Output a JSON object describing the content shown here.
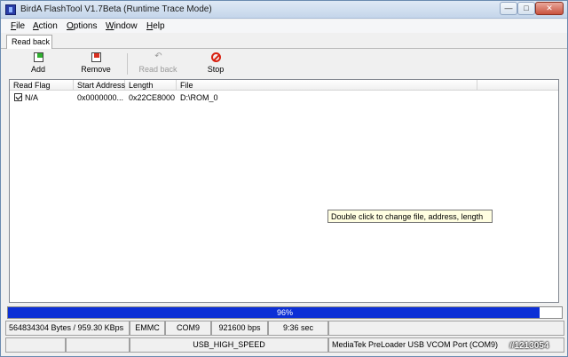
{
  "window": {
    "title": "BirdA FlashTool V1.7Beta (Runtime Trace Mode)"
  },
  "menu": [
    {
      "key": "F",
      "rest": "ile"
    },
    {
      "key": "A",
      "rest": "ction"
    },
    {
      "key": "O",
      "rest": "ptions"
    },
    {
      "key": "W",
      "rest": "indow"
    },
    {
      "key": "H",
      "rest": "elp"
    }
  ],
  "tabs": [
    {
      "label": "Read back"
    }
  ],
  "toolbar": {
    "add": "Add",
    "remove": "Remove",
    "read_back": "Read back",
    "stop": "Stop"
  },
  "list": {
    "columns": [
      "Read Flag",
      "Start Address",
      "Length",
      "File"
    ],
    "rows": [
      {
        "checked": true,
        "flag": "N/A",
        "start": "0x0000000...",
        "length": "0x22CE8000",
        "file": "D:\\ROM_0"
      }
    ]
  },
  "tooltip": "Double click to change file, address, length",
  "progress": {
    "percent": 96,
    "label": "96%"
  },
  "status": {
    "bytes": "564834304 Bytes / 959.30 KBps",
    "storage": "EMMC",
    "port": "COM9",
    "baud": "921600 bps",
    "time": "9:36 sec",
    "usb_speed": "USB_HIGH_SPEED",
    "device": "MediaTek PreLoader USB VCOM Port (COM9)"
  },
  "watermark": "#1213054",
  "colors": {
    "progress": "#0c2fd6",
    "tooltip_bg": "#fffee1",
    "stop": "#d82010"
  }
}
